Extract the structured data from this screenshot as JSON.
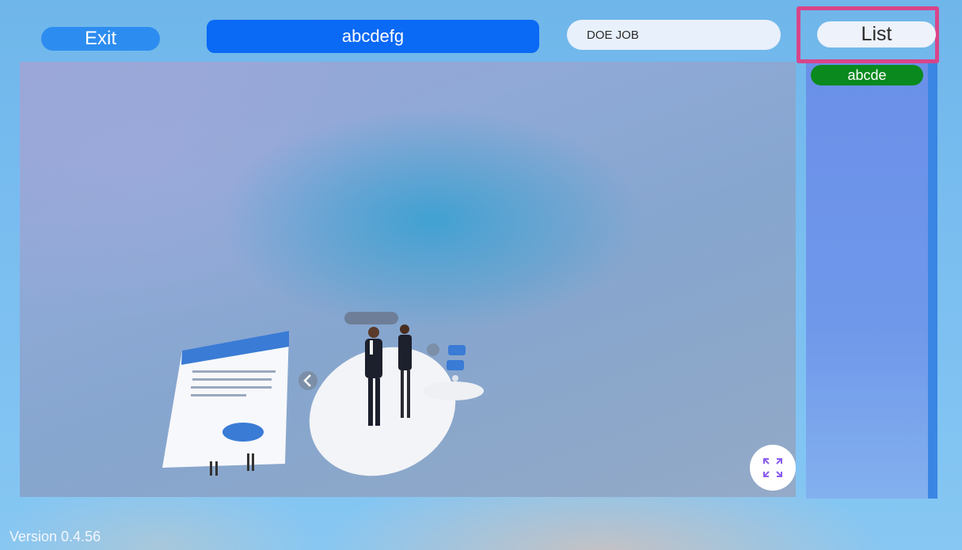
{
  "topbar": {
    "exit_label": "Exit",
    "title": "abcdefg",
    "job_field_value": "DOE JOB",
    "list_label": "List"
  },
  "list_panel": {
    "items": [
      {
        "label": "abcde",
        "color": "#0a8a1e"
      }
    ]
  },
  "viewport": {
    "expand_icon": "expand-arrows-icon",
    "prev_icon": "chevron-left-icon"
  },
  "footer": {
    "version_text": "Version  0.4.56"
  },
  "colors": {
    "exit": "#2d8cf0",
    "title_bar": "#0a69f5",
    "highlight": "#d8458a",
    "list_item": "#0a8a1e"
  }
}
